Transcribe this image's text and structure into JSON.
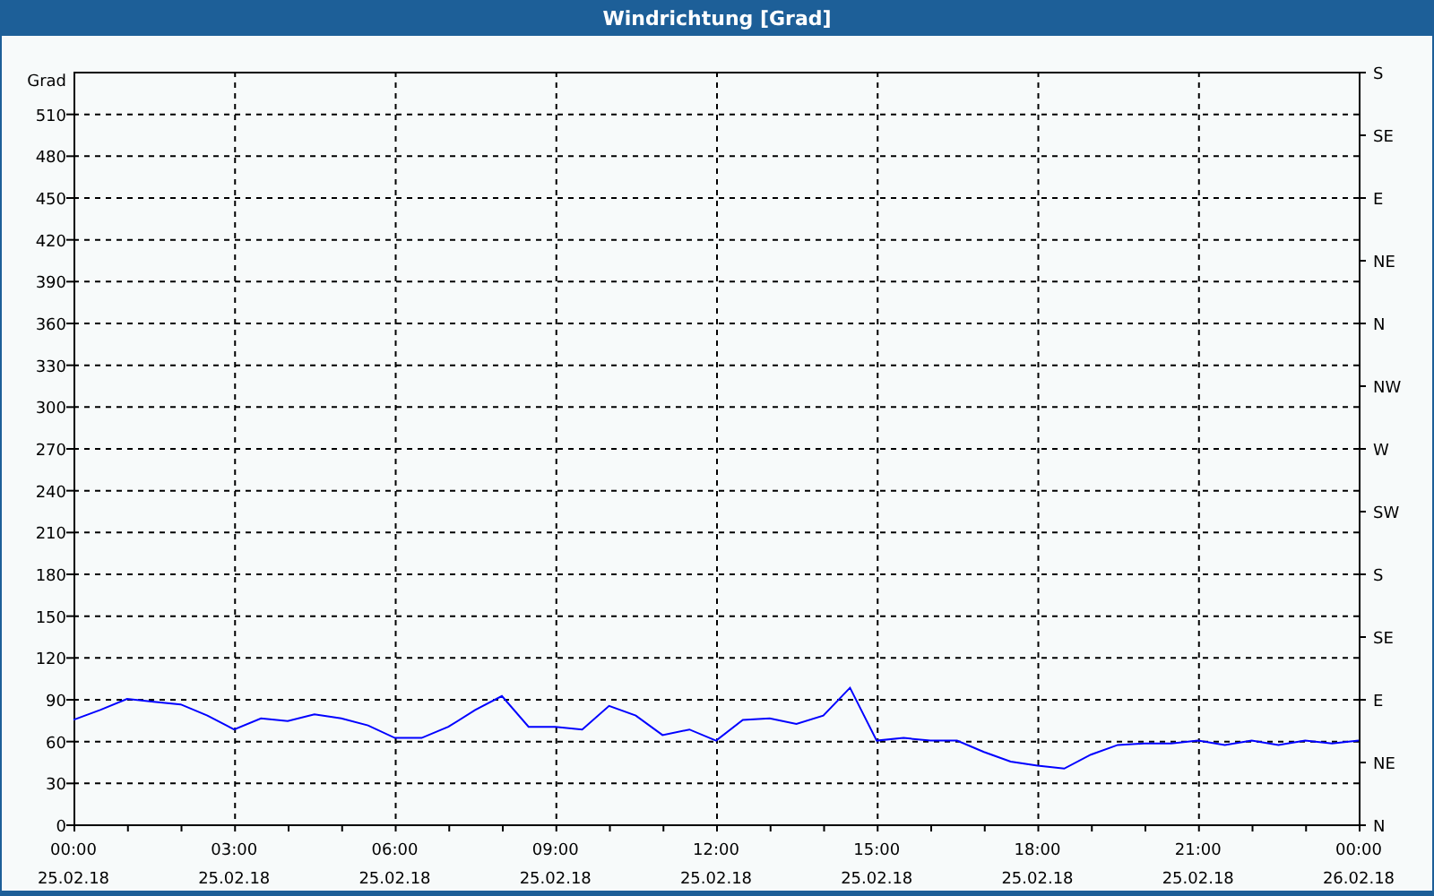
{
  "window": {
    "title": "Windrichtung [Grad]"
  },
  "chart": {
    "chart_data": {
      "type": "line",
      "ylabel": "Grad",
      "grid": true,
      "categories": [
        "00:00\n25.02.18",
        null,
        null,
        null,
        null,
        null,
        "03:00\n25.02.18",
        null,
        null,
        null,
        null,
        null,
        "06:00\n25.02.18",
        null,
        null,
        null,
        null,
        null,
        "09:00\n25.02.18",
        null,
        null,
        null,
        null,
        null,
        "12:00\n25.02.18",
        null,
        null,
        null,
        null,
        null,
        "15:00\n25.02.18",
        null,
        null,
        null,
        null,
        null,
        "18:00\n25.02.18",
        null,
        null,
        null,
        null,
        null,
        "21:00\n25.02.18",
        null,
        null,
        null,
        null,
        null,
        "00:00\n26.02.18"
      ],
      "series": [
        {
          "color": "#0000ff",
          "values": [
            75,
            82,
            90,
            88,
            86,
            78,
            68,
            76,
            74,
            79,
            76,
            71,
            62,
            62,
            70,
            82,
            92,
            70,
            70,
            68,
            85,
            78,
            64,
            68,
            60,
            75,
            76,
            72,
            78,
            98,
            60,
            62,
            60,
            60,
            52,
            45,
            42,
            40,
            50,
            57,
            58,
            58,
            60,
            57,
            60,
            57,
            60,
            58,
            60
          ]
        }
      ],
      "ylim": [
        0,
        540
      ],
      "yticks": [
        0,
        30,
        60,
        90,
        120,
        150,
        180,
        210,
        240,
        270,
        300,
        330,
        360,
        390,
        420,
        450,
        480,
        510
      ]
    },
    "right_axis_labels": [
      "S",
      "SE",
      "E",
      "NE",
      "N",
      "NW",
      "W",
      "SW",
      "S",
      "SE",
      "E",
      "NE",
      "N"
    ]
  }
}
